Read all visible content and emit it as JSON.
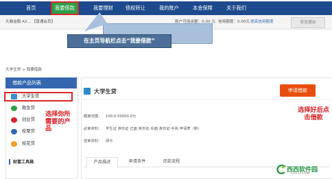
{
  "nav": {
    "items": [
      "首页",
      "我要借款",
      "我要理财",
      "债权转让",
      "我的账户",
      "本金保障",
      "关于我们"
    ],
    "active_index": 1
  },
  "userbar": {
    "greeting": "久融金服 A2... 【普通会员】",
    "balance": "账户可用余额：0.00 元",
    "credit": "信用额度：0.00元",
    "credit_link": "提高信用额度",
    "logout": "安全退出"
  },
  "callout": {
    "text": "在主页导航栏点击“我要借款”"
  },
  "breadcrumb": {
    "text": "大学生贷 > 我要借款"
  },
  "sidebar": {
    "header": "借款产品列表",
    "items": [
      {
        "label": "大学生贷",
        "icon": "student-icon",
        "color": "#3a8fd0"
      },
      {
        "label": "救急贷",
        "icon": "emergency-icon",
        "color": "#2e9e47"
      },
      {
        "label": "创业贷",
        "icon": "startup-icon",
        "color": "#d9262c"
      },
      {
        "label": "校聚贷",
        "icon": "campus-icon",
        "color": "#3567b0"
      },
      {
        "label": "校花贷",
        "icon": "flower-icon",
        "color": "#f0a020"
      }
    ],
    "annotation": "选择你所需要的产品",
    "wealth_tool": "财富工具箱"
  },
  "main": {
    "product_title": "大学生贷",
    "apply_button": "申请借款",
    "annotation": "选择好后点击借款",
    "rows": [
      {
        "label": "额度范围：",
        "value": "100.0-50000.0元"
      },
      {
        "label": "必审资料：",
        "value": "学生证 身份证-正面 身份证-反面 身份证-手执 申请表（新）"
      },
      {
        "label": "选审资料：",
        "value": "绿卡"
      }
    ],
    "tabs": [
      "产品描述",
      "申请条件",
      "还款流程"
    ],
    "active_tab": 0
  },
  "watermark": {
    "brand": "西西软件园",
    "url": "CR173.COM"
  },
  "colors": {
    "nav_bg": "#1c4a8c",
    "active_nav_bg": "#2e9e47",
    "highlight_red": "#d9262c",
    "apply_orange": "#e84f0e",
    "sidebar_header": "#3567b0"
  }
}
